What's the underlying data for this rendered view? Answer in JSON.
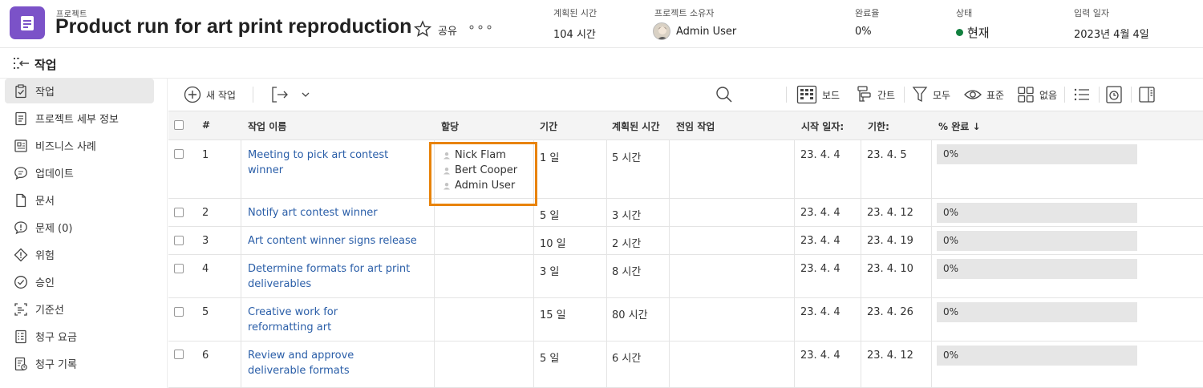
{
  "header": {
    "kicker": "프로젝트",
    "title": "Product run for art print reproduction",
    "share_label": "공유",
    "more_label": "ooo",
    "planned_hours_label": "계획된 시간",
    "planned_hours_value": "104 시간",
    "owner_label": "프로젝트 소유자",
    "owner_value": "Admin User",
    "complete_label": "완료율",
    "complete_value": "0%",
    "status_label": "상태",
    "status_value": "현재",
    "entry_date_label": "입력 일자",
    "entry_date_value": "2023년 4월 4일",
    "status_color": "#12803f",
    "icon_color": "#7b52c8"
  },
  "section": {
    "title": "작업"
  },
  "sidebar": {
    "items": [
      {
        "label": "작업",
        "icon": "task-icon",
        "active": true
      },
      {
        "label": "프로젝트 세부 정보",
        "icon": "details-icon"
      },
      {
        "label": "비즈니스 사례",
        "icon": "business-case-icon"
      },
      {
        "label": "업데이트",
        "icon": "updates-icon"
      },
      {
        "label": "문서",
        "icon": "document-icon"
      },
      {
        "label": "문제 (0)",
        "icon": "issues-icon"
      },
      {
        "label": "위험",
        "icon": "risk-icon"
      },
      {
        "label": "승인",
        "icon": "approval-icon"
      },
      {
        "label": "기준선",
        "icon": "baseline-icon"
      },
      {
        "label": "청구 요금",
        "icon": "billing-rates-icon"
      },
      {
        "label": "청구 기록",
        "icon": "billing-records-icon"
      }
    ]
  },
  "toolbar": {
    "new_task": "새 작업",
    "board": "보드",
    "gantt": "간트",
    "filter": "모두",
    "view": "표준",
    "group": "없음"
  },
  "table": {
    "headers": {
      "num": "#",
      "name": "작업 이름",
      "assign": "할당",
      "duration": "기간",
      "planned": "계획된 시간",
      "predecessor": "전임 작업",
      "start": "시작 일자:",
      "due": "기한:",
      "percent": "% 완료 ↓"
    },
    "rows": [
      {
        "num": "1",
        "name": "Meeting to pick art contest winner",
        "assignees": [
          "Nick Flam",
          "Bert Cooper",
          "Admin User"
        ],
        "duration": "1 일",
        "planned": "5 시간",
        "predecessor": "",
        "start": "23. 4. 4",
        "due": "23. 4. 5",
        "percent_label": "0%",
        "percent": 0
      },
      {
        "num": "2",
        "name": "Notify art contest winner",
        "assignees": [],
        "duration": "5 일",
        "planned": "3 시간",
        "predecessor": "",
        "start": "23. 4. 4",
        "due": "23. 4. 12",
        "percent_label": "0%",
        "percent": 0
      },
      {
        "num": "3",
        "name": "Art content winner signs release",
        "assignees": [],
        "duration": "10 일",
        "planned": "2 시간",
        "predecessor": "",
        "start": "23. 4. 4",
        "due": "23. 4. 19",
        "percent_label": "0%",
        "percent": 0
      },
      {
        "num": "4",
        "name": "Determine formats for art print deliverables",
        "assignees": [],
        "duration": "3 일",
        "planned": "8 시간",
        "predecessor": "",
        "start": "23. 4. 4",
        "due": "23. 4. 10",
        "percent_label": "0%",
        "percent": 0
      },
      {
        "num": "5",
        "name": "Creative work for reformatting art",
        "assignees": [],
        "duration": "15 일",
        "planned": "80 시간",
        "predecessor": "",
        "start": "23. 4. 4",
        "due": "23. 4. 26",
        "percent_label": "0%",
        "percent": 0
      },
      {
        "num": "6",
        "name": "Review and approve deliverable formats",
        "assignees": [],
        "duration": "5 일",
        "planned": "6 시간",
        "predecessor": "",
        "start": "23. 4. 4",
        "due": "23. 4. 12",
        "percent_label": "0%",
        "percent": 0
      }
    ]
  }
}
